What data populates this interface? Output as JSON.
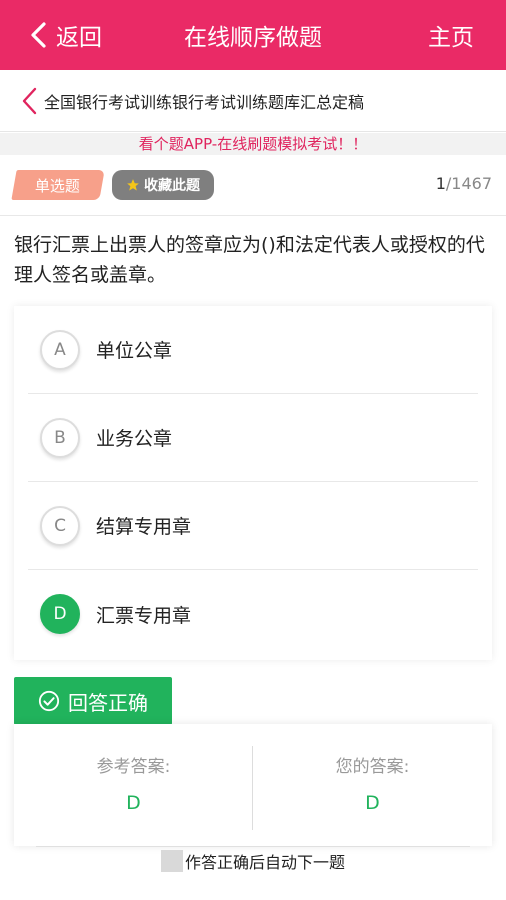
{
  "header": {
    "back_label": "返回",
    "title": "在线顺序做题",
    "home_label": "主页",
    "bg_color": "#ea2a66"
  },
  "breadcrumb": {
    "text": "全国银行考试训练银行考试训练题库汇总定稿"
  },
  "promo": {
    "text": "看个题APP-在线刷题模拟考试！！"
  },
  "question_meta": {
    "type_label": "单选题",
    "favorite_label": "收藏此题",
    "current": "1",
    "total": "/1467"
  },
  "question": {
    "text": "银行汇票上出票人的签章应为()和法定代表人或授权的代理人签名或盖章。"
  },
  "options": [
    {
      "letter": "A",
      "text": "单位公章"
    },
    {
      "letter": "B",
      "text": "业务公章"
    },
    {
      "letter": "C",
      "text": "结算专用章"
    },
    {
      "letter": "D",
      "text": "汇票专用章"
    }
  ],
  "result": {
    "label": "回答正确",
    "color": "#21b35c"
  },
  "answers": {
    "reference_label": "参考答案:",
    "reference_value": "D",
    "yours_label": "您的答案:",
    "yours_value": "D"
  },
  "auto_next": {
    "label": "作答正确后自动下一题"
  }
}
